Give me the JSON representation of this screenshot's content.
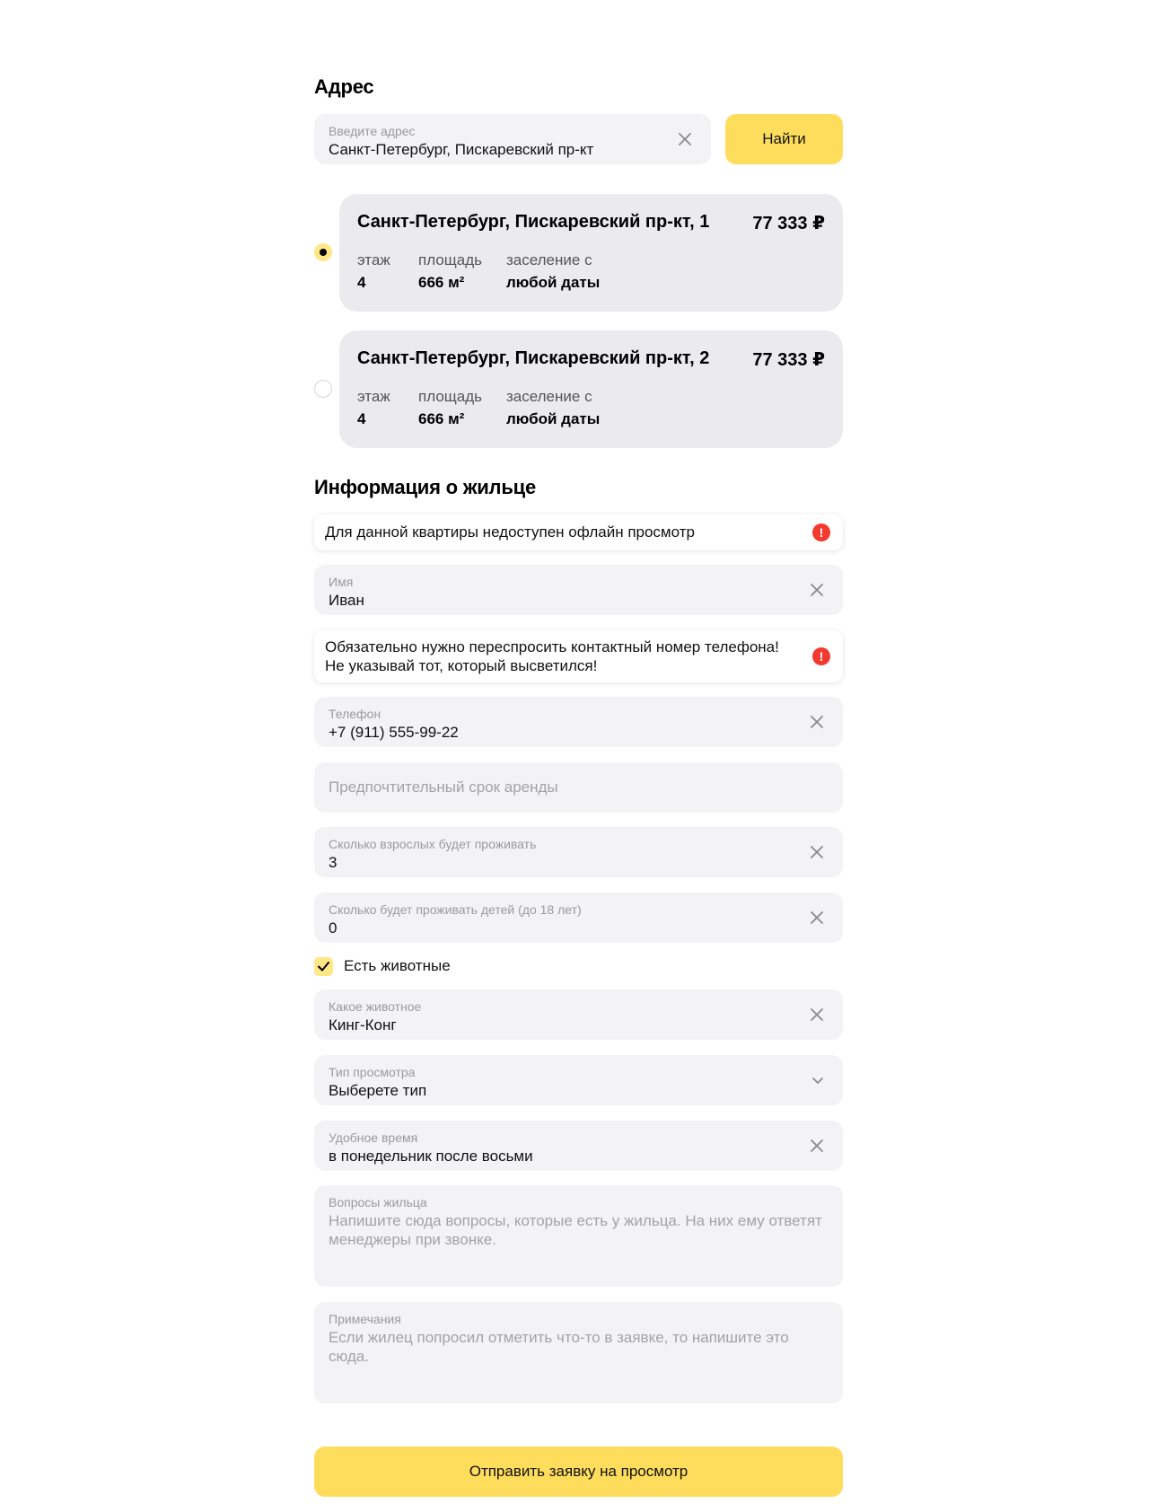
{
  "address_section": {
    "title": "Адрес",
    "input_label": "Введите адрес",
    "input_value": "Санкт-Петербург, Пискаревский пр-кт",
    "find_button": "Найти"
  },
  "listings": [
    {
      "address": "Санкт-Петербург, Пискаревский пр-кт, 1",
      "price": "77 333 ₽",
      "floor_label": "этаж",
      "floor": "4",
      "area_label": "площадь",
      "area": "666 м²",
      "move_in_label": "заселение с",
      "move_in": "любой даты",
      "selected": true
    },
    {
      "address": "Санкт-Петербург, Пискаревский пр-кт, 2",
      "price": "77 333 ₽",
      "floor_label": "этаж",
      "floor": "4",
      "area_label": "площадь",
      "area": "666 м²",
      "move_in_label": "заселение с",
      "move_in": "любой даты",
      "selected": false
    }
  ],
  "tenant_section": {
    "title": "Информация о жильце",
    "alert_offline": "Для данной квартиры недоступен офлайн просмотр",
    "name_label": "Имя",
    "name_value": "Иван",
    "alert_phone_line1": "Обязательно нужно переспросить контактный номер телефона!",
    "alert_phone_line2": "Не указывай тот, который высветился!",
    "phone_label": "Телефон",
    "phone_value": "+7 (911) 555-99-22",
    "term_placeholder": "Предпочтительный срок аренды",
    "adults_label": "Сколько взрослых будет проживать",
    "adults_value": "3",
    "children_label": "Сколько будет проживать детей (до 18 лет)",
    "children_value": "0",
    "pets_checkbox": "Есть животные",
    "pets_checked": true,
    "pet_label": "Какое животное",
    "pet_value": "Кинг-Конг",
    "viewing_label": "Тип просмотра",
    "viewing_value": "Выберете тип",
    "time_label": "Удобное время",
    "time_value": "в понедельник после восьми",
    "questions_label": "Вопросы жильца",
    "questions_placeholder": "Напишите сюда вопросы, которые есть у жильца. На них ему ответят менеджеры при звонке.",
    "notes_label": "Примечания",
    "notes_placeholder": "Если жилец попросил отметить что-то в заявке, то напишите это сюда."
  },
  "submit_button": "Отправить заявку на просмотр",
  "icons": {
    "clear": "close-icon",
    "dropdown": "chevron-down-icon",
    "alert": "exclamation-icon",
    "check": "checkmark-icon"
  },
  "colors": {
    "accent": "#ffdd5c",
    "field_bg": "#f3f3f5",
    "card_bg": "#ebebed",
    "alert_icon": "#f33a30"
  }
}
